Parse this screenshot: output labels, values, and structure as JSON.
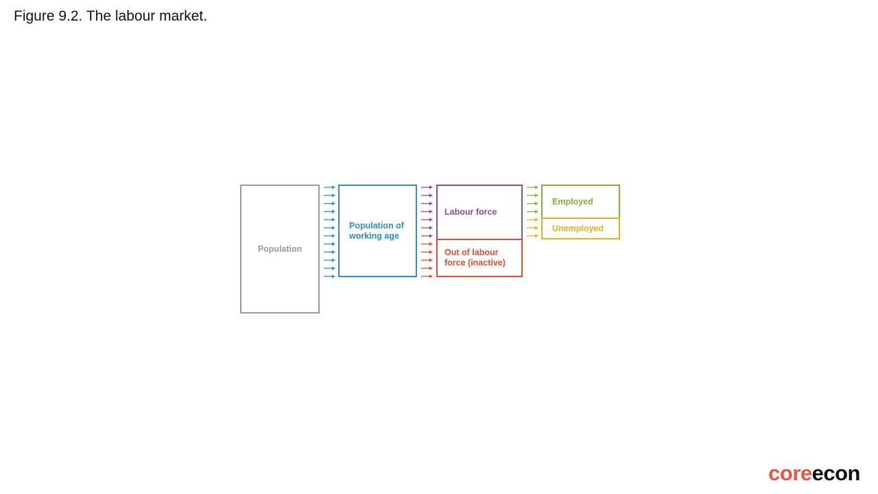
{
  "slide": {
    "title": "Figure 9.2. The labour market."
  },
  "diagram": {
    "nodes": [
      {
        "id": "population",
        "label": "Population",
        "color": "#9a9a9a"
      },
      {
        "id": "working_age",
        "label": "Population of working age",
        "color": "#2e8ec4"
      },
      {
        "id": "labour_force",
        "label": "Labour force",
        "color": "#8a4ea0"
      },
      {
        "id": "inactive",
        "label": "Out of labour force (inactive)",
        "color": "#d9502e"
      },
      {
        "id": "employed",
        "label": "Employed",
        "color": "#7cb33a"
      },
      {
        "id": "unemployed",
        "label": "Unemployed",
        "color": "#e8b020"
      }
    ],
    "edges": [
      {
        "from": "population",
        "to": "working_age",
        "color": "#2e8ec4",
        "count": 12
      },
      {
        "from": "working_age",
        "to": "labour_force",
        "color": "#8a4ea0",
        "count": 7
      },
      {
        "from": "working_age",
        "to": "inactive",
        "color": "#d9502e",
        "count": 5
      },
      {
        "from": "labour_force",
        "to": "employed",
        "color": "#7cb33a",
        "count": 4
      },
      {
        "from": "labour_force",
        "to": "unemployed",
        "color": "#e8b020",
        "count": 3
      }
    ]
  },
  "brand": {
    "part1": "core",
    "part2": "econ",
    "color1": "#e9554a",
    "color2": "#111111"
  }
}
